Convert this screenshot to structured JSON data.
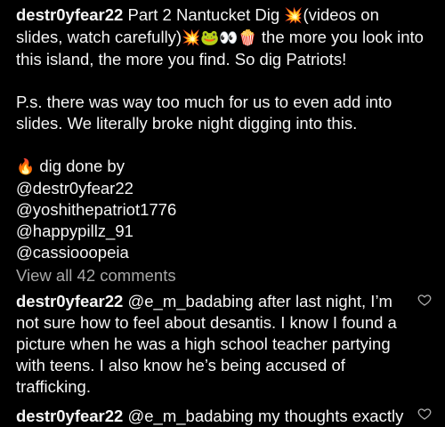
{
  "caption": {
    "username": "destr0yfear22",
    "text_part1": "Part 2 Nantucket Dig",
    "emoji1": "💥",
    "text_part2": "(videos on slides, watch carefully)",
    "emoji2": "💥🐸👀🍿",
    "text_part3": "the more you look into this island, the more you find. So dig Patriots!",
    "ps": "P.s. there was way too much for us to even add into slides. We literally broke night digging into this.",
    "credit_emoji": "🔥",
    "credit_text": "dig done by",
    "mentions": [
      "@destr0yfear22",
      "@yoshithepatriot1776",
      "@happypillz_91",
      "@cassiooopeia"
    ]
  },
  "view_all": "View all 42 comments",
  "comments": [
    {
      "username": "destr0yfear22",
      "mention": "@e_m_badabing",
      "text": "after last night, I’m not sure how to feel about desantis. I know I found a picture when he was a high school teacher partying with teens. I also know he’s being accused of trafficking."
    },
    {
      "username": "destr0yfear22",
      "mention": "@e_m_badabing",
      "text": "my thoughts exactly"
    }
  ],
  "icons": {
    "like": "heart-outline-icon"
  },
  "colors": {
    "background": "#000000",
    "text": "#f5f5f5",
    "muted": "#a8a8a8"
  }
}
